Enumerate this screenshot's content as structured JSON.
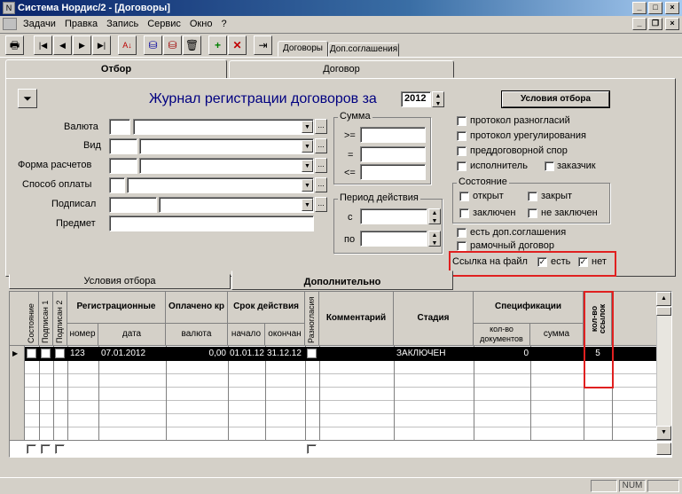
{
  "window": {
    "title": "Система Нордис/2 - [Договоры]",
    "minimize": "_",
    "maximize": "□",
    "close": "×",
    "child_minimize": "_",
    "child_restore": "❐",
    "child_close": "×"
  },
  "menu": [
    "Задачи",
    "Правка",
    "Запись",
    "Сервис",
    "Окно",
    "?"
  ],
  "toolbar_tabs": [
    "Договоры",
    "Доп.соглашения"
  ],
  "main_tabs": [
    "Отбор",
    "Договор"
  ],
  "form": {
    "journal_title": "Журнал регистрации договоров за",
    "year": "2012",
    "conditions_button": "Условия отбора",
    "labels": {
      "currency": "Валюта",
      "kind": "Вид",
      "payment_form": "Форма расчетов",
      "payment_method": "Способ оплаты",
      "signed": "Подписал",
      "subject": "Предмет"
    },
    "sum_group": "Сумма",
    "sum_ops": [
      ">=",
      "=",
      "<="
    ],
    "period_group": "Период действия",
    "period_from": "с",
    "period_to": "по",
    "checks": [
      "протокол разногласий",
      "протокол урегулирования",
      "преддоговорной спор"
    ],
    "executor": "исполнитель",
    "customer": "заказчик",
    "state_group": "Состояние",
    "state_open": "открыт",
    "state_closed": "закрыт",
    "state_concluded": "заключен",
    "state_not_concluded": "не заключен",
    "has_additional": "есть доп.соглашения",
    "frame_contract": "рамочный договор",
    "file_link_label": "Ссылка на файл",
    "file_link_yes": "есть",
    "file_link_no": "нет",
    "file_link_yes_checked": true,
    "file_link_no_checked": true
  },
  "bottom_tabs": [
    "Условия отбора",
    "Дополнительно"
  ],
  "grid": {
    "vertical_heads": [
      "Состояние",
      "Подписан 1",
      "Подписан 2"
    ],
    "group_reg": "Регистрационные",
    "reg_number": "номер",
    "reg_date": "дата",
    "group_paid": "Оплачено кр",
    "paid_currency": "валюта",
    "group_term": "Срок действия",
    "term_start": "начало",
    "term_end": "окончан",
    "disagreement": "Разногласия",
    "comment": "Комментарий",
    "stage": "Стадия",
    "group_spec": "Спецификации",
    "spec_count": "кол-во документов",
    "spec_sum": "сумма",
    "links_count": "кол-во ссылок",
    "row": {
      "number": "123",
      "date": "07.01.2012",
      "paid": "0,00",
      "start": "01.01.12",
      "end": "31.12.12",
      "stage": "ЗАКЛЮЧЕН",
      "docs": "0",
      "links": "5"
    }
  },
  "status": {
    "num": "NUM"
  },
  "colors": {
    "title_bar": "#0a246a",
    "highlight": "#e02020",
    "journal_title": "#000080",
    "selected_row": "#000000"
  }
}
